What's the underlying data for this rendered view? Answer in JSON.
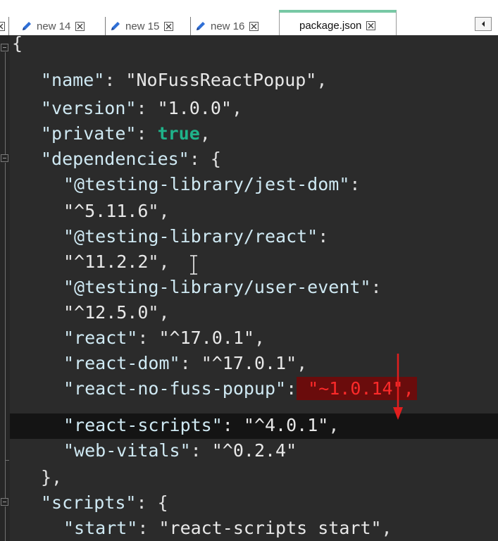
{
  "tabs": [
    {
      "label": "new 14",
      "icon": "pencil-icon",
      "active": false
    },
    {
      "label": "new 15",
      "icon": "pencil-icon",
      "active": false
    },
    {
      "label": "new 16",
      "icon": "pencil-icon",
      "active": false
    },
    {
      "label": "package.json",
      "icon": "",
      "active": true
    }
  ],
  "colors": {
    "accent_tab": "#78c8a5",
    "editor_bg": "#2b2b2b",
    "current_line_bg": "#141414",
    "highlight_bg": "#6a0c0c",
    "highlight_text": "#ff2a2a",
    "annotation_arrow": "#e01e1e",
    "boolean": "#1fb38a"
  },
  "code": {
    "line01": {
      "open": "{"
    },
    "line02": {
      "key": "\"name\"",
      "sep": ": ",
      "value": "\"NoFussReactPopup\"",
      "end": ","
    },
    "line03": {
      "key": "\"version\"",
      "sep": ": ",
      "value": "\"1.0.0\"",
      "end": ","
    },
    "line04": {
      "key": "\"private\"",
      "sep": ": ",
      "value": "true",
      "end": ","
    },
    "line05": {
      "key": "\"dependencies\"",
      "sep": ": ",
      "value": "{"
    },
    "line06": {
      "key": "\"@testing-library/jest-dom\"",
      "sep": ":"
    },
    "line07": {
      "value": "\"^5.11.6\"",
      "end": ","
    },
    "line08": {
      "key": "\"@testing-library/react\"",
      "sep": ":"
    },
    "line09": {
      "value": "\"^11.2.2\"",
      "end": ","
    },
    "line10": {
      "key": "\"@testing-library/user-event\"",
      "sep": ":"
    },
    "line11": {
      "value": "\"^12.5.0\"",
      "end": ","
    },
    "line12": {
      "key": "\"react\"",
      "sep": ": ",
      "value": "\"^17.0.1\"",
      "end": ","
    },
    "line13": {
      "key": "\"react-dom\"",
      "sep": ": ",
      "value": "\"^17.0.1\"",
      "end": ","
    },
    "line14": {
      "key": "\"react-no-fuss-popup\"",
      "sep": ":",
      "value": "\"~1.0.14\","
    },
    "line15": {
      "key": "\"react-scripts\"",
      "sep": ": ",
      "value": "\"^4.0.1\"",
      "end": ","
    },
    "line16": {
      "key": "\"web-vitals\"",
      "sep": ": ",
      "value": "\"^0.2.4\""
    },
    "line17": {
      "close": "},"
    },
    "line18": {
      "key": "\"scripts\"",
      "sep": ": ",
      "value": "{"
    },
    "line19": {
      "key": "\"start\"",
      "sep": ": ",
      "value": "\"react-scripts start\"",
      "end": ","
    }
  }
}
